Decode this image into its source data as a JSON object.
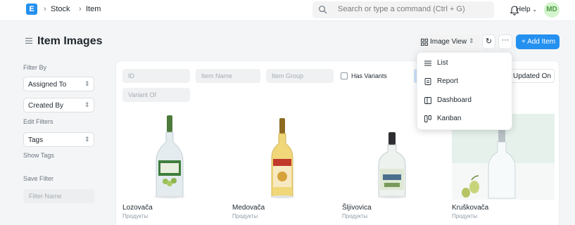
{
  "navbar": {
    "logo_letter": "E",
    "breadcrumb": [
      "Stock",
      "Item"
    ],
    "search_placeholder": "Search or type a command (Ctrl + G)",
    "help_label": "Help",
    "avatar_initials": "MD"
  },
  "page": {
    "title": "Item Images",
    "view_button_label": "Image View",
    "refresh_label": "↻",
    "more_label": "···",
    "add_button_label": "+ Add Item"
  },
  "sidebar": {
    "filter_by_label": "Filter By",
    "assigned_to": "Assigned To",
    "created_by": "Created By",
    "edit_filters_label": "Edit Filters",
    "tags": "Tags",
    "show_tags_label": "Show Tags",
    "save_filter_label": "Save Filter",
    "filter_name_placeholder": "Filter Name"
  },
  "filters": {
    "id": "ID",
    "item_name": "Item Name",
    "item_group": "Item Group",
    "has_variants": "Has Variants",
    "variant_of": "Variant Of",
    "sort_label": "Updated On"
  },
  "view_menu": {
    "items": [
      {
        "label": "List",
        "icon": "list-icon"
      },
      {
        "label": "Report",
        "icon": "report-icon"
      },
      {
        "label": "Dashboard",
        "icon": "dashboard-icon"
      },
      {
        "label": "Kanban",
        "icon": "kanban-icon"
      }
    ]
  },
  "items": [
    {
      "name": "Lozovača",
      "group": "Продукты"
    },
    {
      "name": "Medovača",
      "group": "Продукты"
    },
    {
      "name": "Šljivovica",
      "group": "Продукты"
    },
    {
      "name": "Kruškovača",
      "group": "Продукты"
    }
  ],
  "colors": {
    "primary": "#2490ef",
    "background": "#f4f5f6",
    "avatar_bg": "#d4f4ce",
    "avatar_fg": "#4f9a45"
  }
}
